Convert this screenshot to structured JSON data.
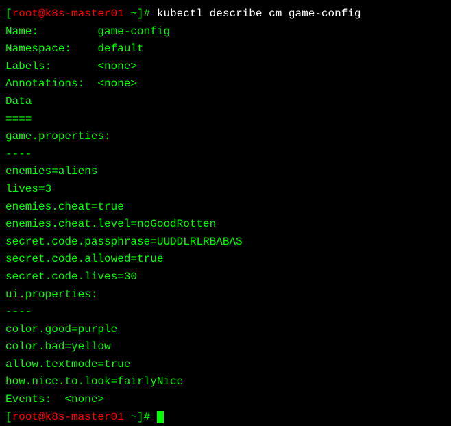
{
  "prompt": {
    "open": "[",
    "host": "root@k8s-master01",
    "close": " ~]# "
  },
  "command": "kubectl describe cm game-config",
  "output": {
    "name_label": "Name:         ",
    "name_value": "game-config",
    "namespace_label": "Namespace:    ",
    "namespace_value": "default",
    "labels_label": "Labels:       ",
    "labels_value": "<none>",
    "annotations_label": "Annotations:  ",
    "annotations_value": "<none>",
    "blank1": "",
    "data_header": "Data",
    "data_divider": "====",
    "game_props_header": "game.properties:",
    "game_props_divider": "----",
    "game_prop_1": "enemies=aliens",
    "game_prop_2": "lives=3",
    "game_prop_3": "enemies.cheat=true",
    "game_prop_4": "enemies.cheat.level=noGoodRotten",
    "game_prop_5": "secret.code.passphrase=UUDDLRLRBABAS",
    "game_prop_6": "secret.code.allowed=true",
    "game_prop_7": "secret.code.lives=30",
    "blank2": "",
    "ui_props_header": "ui.properties:",
    "ui_props_divider": "----",
    "ui_prop_1": "color.good=purple",
    "ui_prop_2": "color.bad=yellow",
    "ui_prop_3": "allow.textmode=true",
    "ui_prop_4": "how.nice.to.look=fairlyNice",
    "blank3": "",
    "events_label": "Events:  ",
    "events_value": "<none>"
  }
}
